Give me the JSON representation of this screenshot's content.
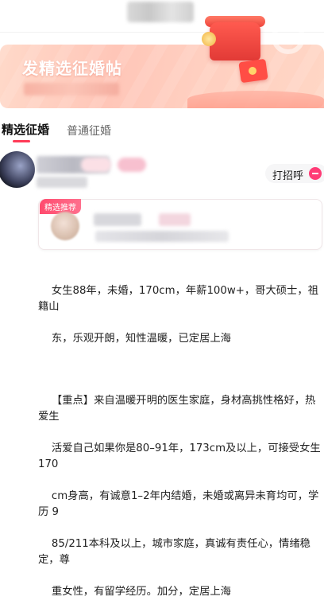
{
  "banner": {
    "title": "发精选征婚帖"
  },
  "tabs": [
    {
      "label": "精选征婚",
      "active": true
    },
    {
      "label": "普通征婚",
      "active": false
    }
  ],
  "post": {
    "greet_label": "打招呼",
    "recommended_badge": "精选推荐",
    "paragraph1_lines": [
      "女生88年，未婚，170cm，年薪100w+，哥大硕士，祖籍山",
      "东，乐观开朗，知性温暖，已定居上海"
    ],
    "paragraph2_lines": [
      "【重点】来自温暖开明的医生家庭，身材高挑性格好，热爱生",
      "活爱自己如果你是80–91年，173cm及以上，可接受女生170",
      "cm身高，有诚意1–2年内结婚，未婚或离异未育均可，学历 9",
      "85/211本科及以上，城市家庭，真诚有责任心，情绪稳定，尊",
      "重女性，有留学经历。加分，定居上海"
    ]
  },
  "colors": {
    "accent": "#ff3b57",
    "badge": "#ff4b6e"
  },
  "icons": [
    "gift-box-icon",
    "red-envelope-icon",
    "chat-bubble-icon"
  ]
}
